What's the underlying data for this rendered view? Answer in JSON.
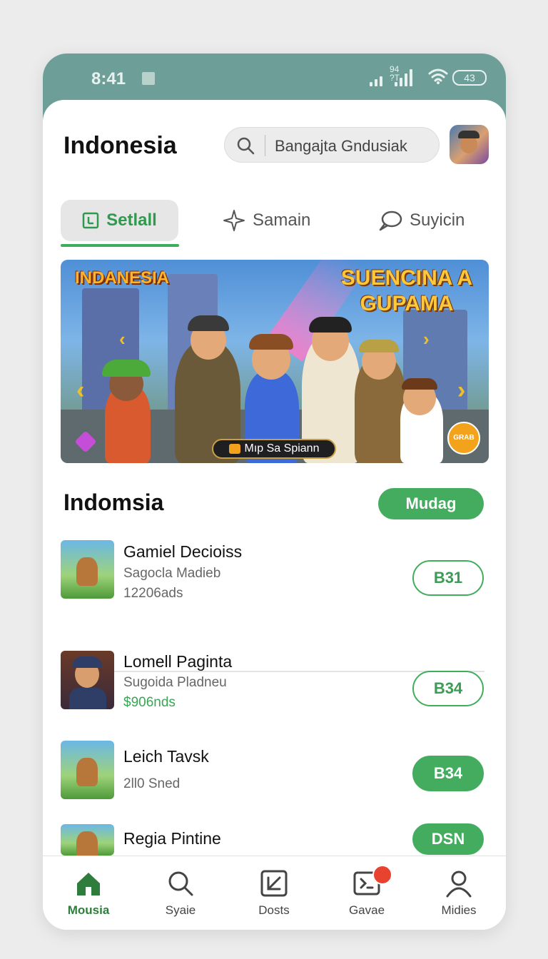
{
  "status_bar": {
    "time": "8:41",
    "signal_text": "94\n?T",
    "battery": "43"
  },
  "header": {
    "title": "Indonesia",
    "search_text": "Bangajta Gndusiak"
  },
  "tabs": [
    {
      "label": "Setlall",
      "icon": "app-box-icon",
      "active": true
    },
    {
      "label": "Samain",
      "icon": "sparkle-icon",
      "active": false
    },
    {
      "label": "Suyicin",
      "icon": "chat-bubble-icon",
      "active": false
    }
  ],
  "banner": {
    "left_title": "INDANESIA",
    "right_title": "SUENCINA A GUPAMA",
    "pill_label": "Mıp Sa Spiann",
    "badge_text": "GRAB"
  },
  "section": {
    "title": "Indomsia",
    "button_label": "Mudag"
  },
  "games": [
    {
      "name": "Gamiel Decioiss",
      "subtitle": "Sagocla Madieb",
      "meta": "12206ads",
      "price": "B31",
      "style": "outline"
    },
    {
      "name": "Lomell Paginta",
      "subtitle": "Sugoida Pladneu",
      "meta": "$906nds",
      "price": "B34",
      "style": "outline"
    },
    {
      "name": "Leich Tavsk",
      "subtitle": "",
      "meta": "2ll0 Sned",
      "price": "B34",
      "style": "filled"
    },
    {
      "name": "Regia Pintine",
      "subtitle": "",
      "meta": "",
      "price": "DSN",
      "style": "filled"
    }
  ],
  "bottom_nav": [
    {
      "label": "Mousia",
      "icon": "home-icon",
      "active": true
    },
    {
      "label": "Syaie",
      "icon": "search-icon",
      "active": false
    },
    {
      "label": "Dosts",
      "icon": "edit-box-icon",
      "active": false
    },
    {
      "label": "Gavae",
      "icon": "game-controller-icon",
      "active": false
    },
    {
      "label": "Midies",
      "icon": "person-icon",
      "active": false
    }
  ],
  "colors": {
    "accent": "#44ac5f",
    "status_bar": "#6d9f98",
    "badge": "#e8432f"
  }
}
